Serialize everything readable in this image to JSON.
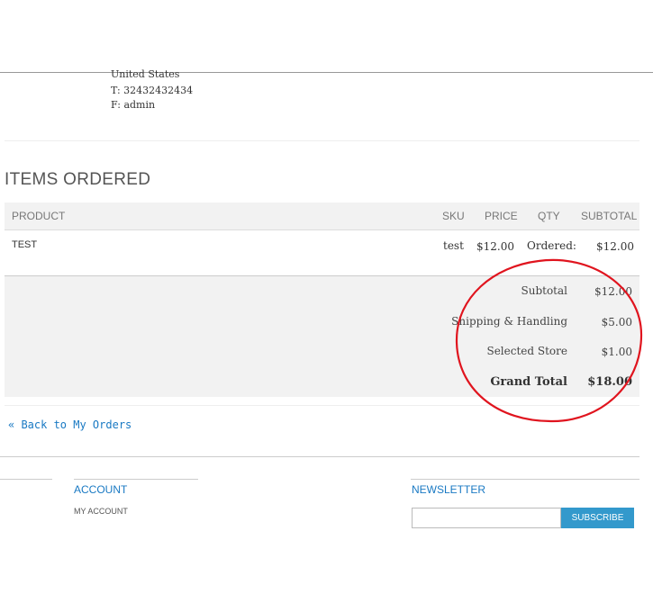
{
  "address": {
    "country": "United States",
    "phone": "T: 32432432434",
    "fax": "F: admin"
  },
  "items_ordered": {
    "title": "ITEMS ORDERED",
    "headers": {
      "product": "PRODUCT",
      "sku": "SKU",
      "price": "PRICE",
      "qty": "QTY",
      "subtotal": "SUBTOTAL"
    },
    "rows": [
      {
        "product": "TEST",
        "sku": "test",
        "price": "$12.00",
        "qty": "Ordered:",
        "subtotal": "$12.00"
      }
    ]
  },
  "totals": {
    "subtotal_label": "Subtotal",
    "subtotal_value": "$12.00",
    "shipping_label": "Shipping & Handling",
    "shipping_value": "$5.00",
    "store_label": "Selected Store",
    "store_value": "$1.00",
    "grand_label": "Grand Total",
    "grand_value": "$18.00"
  },
  "back_link": "« Back to My Orders",
  "footer": {
    "account_title": "ACCOUNT",
    "my_account": "MY ACCOUNT",
    "newsletter_title": "NEWSLETTER",
    "newsletter_placeholder": "",
    "subscribe_label": "SUBSCRIBE"
  },
  "colors": {
    "link": "#1979c3",
    "button": "#3399cc",
    "annotation": "#e0141e"
  }
}
